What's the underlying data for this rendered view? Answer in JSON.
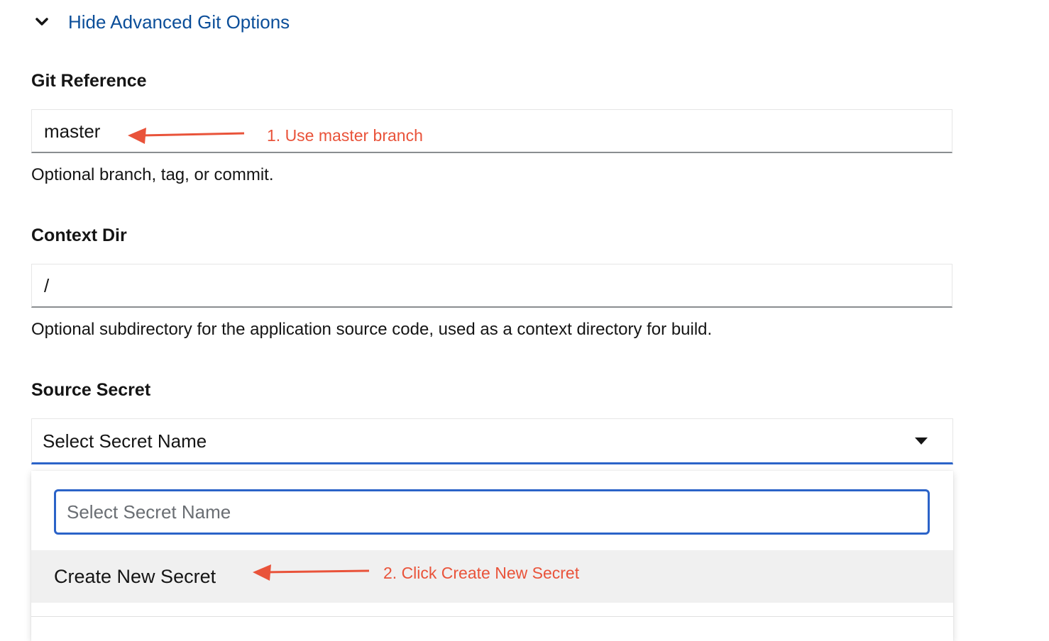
{
  "toggle": {
    "label": "Hide Advanced Git Options",
    "icon": "chevron-down-icon"
  },
  "git_reference": {
    "label": "Git Reference",
    "value": "master",
    "helper": "Optional branch, tag, or commit."
  },
  "context_dir": {
    "label": "Context Dir",
    "value": "/",
    "helper": "Optional subdirectory for the application source code, used as a context directory for build."
  },
  "source_secret": {
    "label": "Source Secret",
    "selected": "Select Secret Name",
    "caret_icon": "caret-down-icon",
    "search_placeholder": "Select Secret Name",
    "items": [
      {
        "label": "Create New Secret"
      }
    ]
  },
  "annotations": {
    "step1": "1. Use master branch",
    "step2": "2. Click Create New Secret",
    "color": "#e9533a"
  },
  "colors": {
    "link": "#0b4e99",
    "focus_border": "#2b63c8",
    "hover_bg": "#f0f0f0"
  }
}
